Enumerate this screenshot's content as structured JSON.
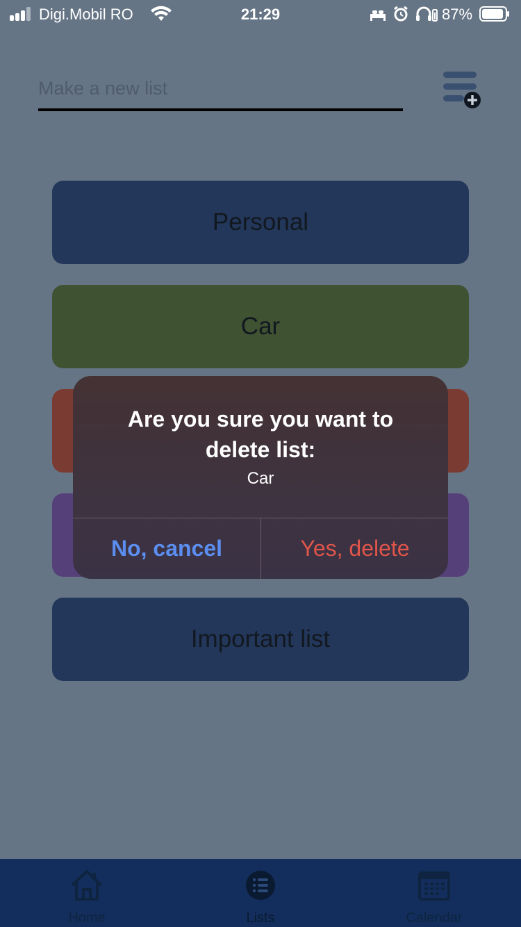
{
  "status_bar": {
    "carrier": "Digi.Mobil RO",
    "time": "21:29",
    "battery_percent": "87%"
  },
  "new_list": {
    "placeholder": "Make a new list",
    "add_icon": "list-add-icon"
  },
  "lists": [
    {
      "label": "Personal",
      "color": "#23375a"
    },
    {
      "label": "Car",
      "color": "#3f5232"
    },
    {
      "label": "",
      "color": "#7a3b32"
    },
    {
      "label": "",
      "color": "#56407a"
    },
    {
      "label": "Important list",
      "color": "#23375a"
    }
  ],
  "alert": {
    "title": "Are you sure you want to delete list:",
    "message": "Car",
    "cancel_label": "No, cancel",
    "confirm_label": "Yes, delete"
  },
  "tab_bar": {
    "tabs": [
      {
        "label": "Home",
        "icon": "home-icon"
      },
      {
        "label": "Lists",
        "icon": "list-icon"
      },
      {
        "label": "Calendar",
        "icon": "calendar-icon"
      }
    ]
  },
  "colors": {
    "background_dimmed": "#667585",
    "tab_bar": "#132e5c",
    "cancel": "#5b8ef0",
    "destructive": "#e0554a"
  }
}
